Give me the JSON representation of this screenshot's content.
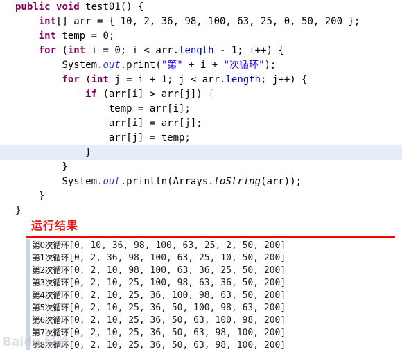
{
  "code": {
    "language": "java",
    "lines": [
      {
        "indent": 0,
        "highlight": false,
        "tokens": [
          {
            "t": "public",
            "c": "kw"
          },
          {
            "t": " ",
            "c": "plain"
          },
          {
            "t": "void",
            "c": "kw"
          },
          {
            "t": " test01() {",
            "c": "plain"
          }
        ]
      },
      {
        "indent": 1,
        "highlight": false,
        "tokens": [
          {
            "t": "int",
            "c": "kw"
          },
          {
            "t": "[] arr = { 10, 2, 36, 98, 100, 63, 25, 0, 50, 200 };",
            "c": "plain"
          }
        ]
      },
      {
        "indent": 1,
        "highlight": false,
        "tokens": [
          {
            "t": "int",
            "c": "kw"
          },
          {
            "t": " temp = 0;",
            "c": "plain"
          }
        ]
      },
      {
        "indent": 1,
        "highlight": false,
        "tokens": [
          {
            "t": "for",
            "c": "kw"
          },
          {
            "t": " (",
            "c": "plain"
          },
          {
            "t": "int",
            "c": "kw"
          },
          {
            "t": " i = 0; i < arr.",
            "c": "plain"
          },
          {
            "t": "length",
            "c": "field"
          },
          {
            "t": " - 1; i++) {",
            "c": "plain"
          }
        ]
      },
      {
        "indent": 2,
        "highlight": false,
        "tokens": [
          {
            "t": "System.",
            "c": "plain"
          },
          {
            "t": "out",
            "c": "static"
          },
          {
            "t": ".print(",
            "c": "plain"
          },
          {
            "t": "\"第\"",
            "c": "str"
          },
          {
            "t": " + i + ",
            "c": "plain"
          },
          {
            "t": "\"次循环\"",
            "c": "str"
          },
          {
            "t": ");",
            "c": "plain"
          }
        ]
      },
      {
        "indent": 2,
        "highlight": false,
        "tokens": [
          {
            "t": "for",
            "c": "kw"
          },
          {
            "t": " (",
            "c": "plain"
          },
          {
            "t": "int",
            "c": "kw"
          },
          {
            "t": " j = i + 1; j < arr.",
            "c": "plain"
          },
          {
            "t": "length",
            "c": "field"
          },
          {
            "t": "; j++) {",
            "c": "plain"
          }
        ]
      },
      {
        "indent": 3,
        "highlight": false,
        "tokens": [
          {
            "t": "if",
            "c": "kw"
          },
          {
            "t": " (arr[i] > arr[j]) ",
            "c": "plain"
          },
          {
            "t": "{",
            "c": "gray"
          }
        ]
      },
      {
        "indent": 4,
        "highlight": false,
        "tokens": [
          {
            "t": "temp = arr[i];",
            "c": "plain"
          }
        ]
      },
      {
        "indent": 4,
        "highlight": false,
        "tokens": [
          {
            "t": "arr[i] = arr[j];",
            "c": "plain"
          }
        ]
      },
      {
        "indent": 4,
        "highlight": false,
        "tokens": [
          {
            "t": "arr[j] = temp;",
            "c": "plain"
          }
        ]
      },
      {
        "indent": 3,
        "highlight": true,
        "tokens": [
          {
            "t": "}",
            "c": "plain"
          }
        ]
      },
      {
        "indent": 2,
        "highlight": false,
        "tokens": [
          {
            "t": "}",
            "c": "plain"
          }
        ]
      },
      {
        "indent": 2,
        "highlight": false,
        "tokens": [
          {
            "t": "System.",
            "c": "plain"
          },
          {
            "t": "out",
            "c": "static"
          },
          {
            "t": ".println(Arrays.",
            "c": "plain"
          },
          {
            "t": "toString",
            "c": "method-i"
          },
          {
            "t": "(arr));",
            "c": "plain"
          }
        ]
      },
      {
        "indent": 1,
        "highlight": false,
        "tokens": [
          {
            "t": "}",
            "c": "plain"
          }
        ]
      },
      {
        "indent": 0,
        "highlight": false,
        "tokens": [
          {
            "t": "}",
            "c": "plain"
          }
        ]
      }
    ]
  },
  "result": {
    "title": "运行结果",
    "title_color": "#f01414",
    "rule_color": "#ff0000"
  },
  "console": {
    "lines": [
      {
        "label": "第0次循环",
        "array": "[0, 10, 36, 98, 100, 63, 25, 2, 50, 200]"
      },
      {
        "label": "第1次循环",
        "array": "[0, 2, 36, 98, 100, 63, 25, 10, 50, 200]"
      },
      {
        "label": "第2次循环",
        "array": "[0, 2, 10, 98, 100, 63, 36, 25, 50, 200]"
      },
      {
        "label": "第3次循环",
        "array": "[0, 2, 10, 25, 100, 98, 63, 36, 50, 200]"
      },
      {
        "label": "第4次循环",
        "array": "[0, 2, 10, 25, 36, 100, 98, 63, 50, 200]"
      },
      {
        "label": "第5次循环",
        "array": "[0, 2, 10, 25, 36, 50, 100, 98, 63, 200]"
      },
      {
        "label": "第6次循环",
        "array": "[0, 2, 10, 25, 36, 50, 63, 100, 98, 200]"
      },
      {
        "label": "第7次循环",
        "array": "[0, 2, 10, 25, 36, 50, 63, 98, 100, 200]"
      },
      {
        "label": "第8次循环",
        "array": "[0, 2, 10, 25, 36, 50, 63, 98, 100, 200]"
      }
    ]
  },
  "watermark": {
    "text": "Baidu 经验"
  }
}
